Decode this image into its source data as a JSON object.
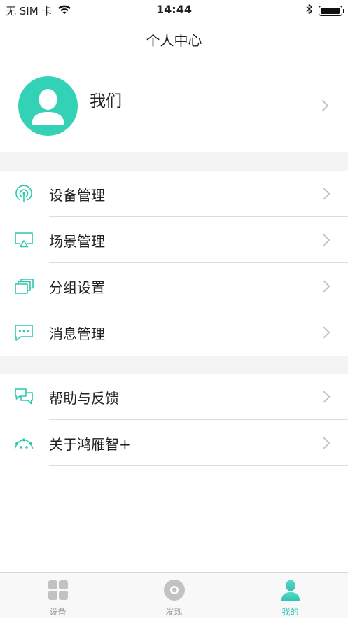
{
  "status_bar": {
    "carrier": "无 SIM 卡",
    "time": "14:44",
    "battery_level": 0.95
  },
  "nav": {
    "title": "个人中心"
  },
  "profile": {
    "name": "我们"
  },
  "menu_groups": [
    [
      {
        "label": "设备管理",
        "icon": "radar-signal-icon"
      },
      {
        "label": "场景管理",
        "icon": "screen-cast-icon"
      },
      {
        "label": "分组设置",
        "icon": "stacked-windows-icon"
      },
      {
        "label": "消息管理",
        "icon": "message-bubble-icon"
      }
    ],
    [
      {
        "label": "帮助与反馈",
        "icon": "chat-bubbles-icon"
      },
      {
        "label": "关于鸿雁智+",
        "icon": "vector-curve-icon"
      }
    ]
  ],
  "tab_bar": {
    "items": [
      {
        "label": "设备",
        "icon": "grid-icon",
        "active": false
      },
      {
        "label": "发现",
        "icon": "disc-icon",
        "active": false
      },
      {
        "label": "我的",
        "icon": "person-icon",
        "active": true
      }
    ]
  },
  "colors": {
    "accent": "#2fc6b0",
    "avatar_bg": "#33d1b6",
    "gap_bg": "#f4f4f4",
    "tab_inactive": "#999999"
  }
}
